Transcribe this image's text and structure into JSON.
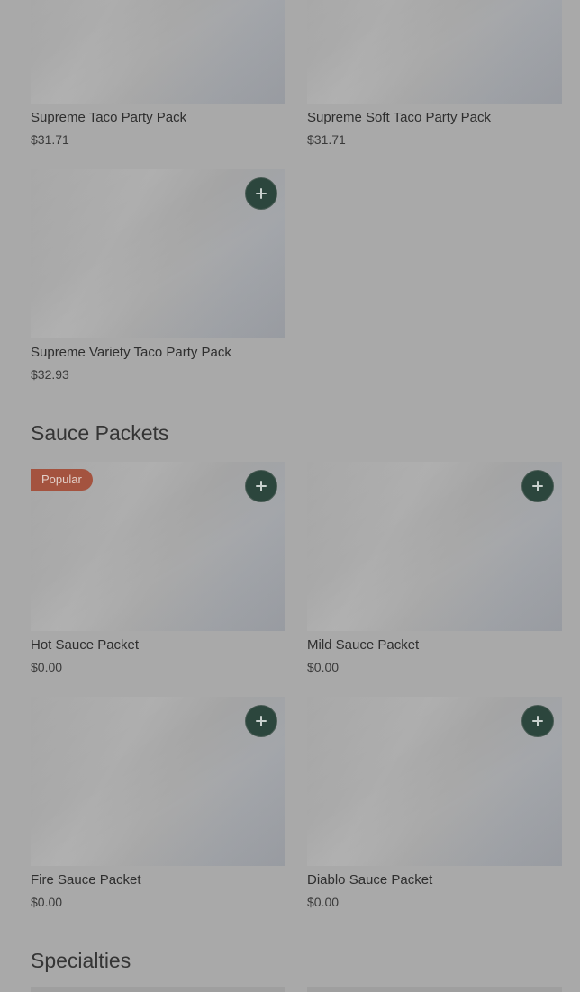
{
  "sections": [
    {
      "title": "",
      "items": [
        {
          "name": "Supreme Taco Party Pack",
          "price": "$31.71"
        },
        {
          "name": "Supreme Soft Taco Party Pack",
          "price": "$31.71"
        },
        {
          "name": "Supreme Variety Taco Party Pack",
          "price": "$32.93"
        }
      ]
    },
    {
      "title": "Sauce Packets",
      "items": [
        {
          "name": "Hot Sauce Packet",
          "price": "$0.00",
          "badge": "Popular"
        },
        {
          "name": "Mild Sauce Packet",
          "price": "$0.00"
        },
        {
          "name": "Fire Sauce Packet",
          "price": "$0.00"
        },
        {
          "name": "Diablo Sauce Packet",
          "price": "$0.00"
        }
      ]
    },
    {
      "title": "Specialties",
      "items": []
    }
  ],
  "colors": {
    "overlay_background": "#a9a9a9",
    "add_button": "#2c463d",
    "badge": "#a4533f"
  },
  "icons": {
    "add": "plus-icon"
  }
}
